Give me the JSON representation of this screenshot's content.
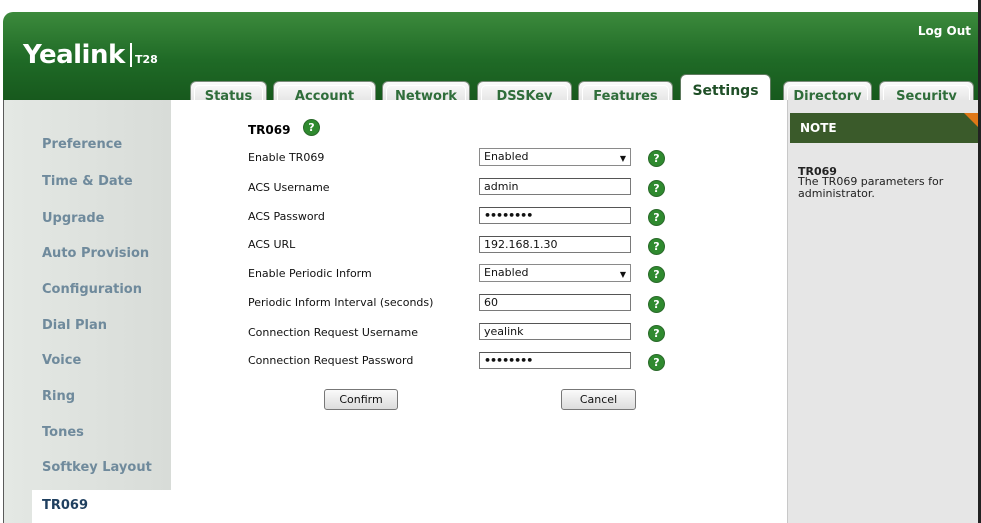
{
  "header": {
    "logo": "Yealink",
    "model": "T28",
    "logout": "Log Out"
  },
  "tabs": [
    {
      "label": "Status",
      "active": false
    },
    {
      "label": "Account",
      "active": false
    },
    {
      "label": "Network",
      "active": false
    },
    {
      "label": "DSSKey",
      "active": false
    },
    {
      "label": "Features",
      "active": false
    },
    {
      "label": "Settings",
      "active": true
    },
    {
      "label": "Directory",
      "active": false
    },
    {
      "label": "Security",
      "active": false
    }
  ],
  "sidebar": {
    "items": [
      {
        "label": "Preference"
      },
      {
        "label": "Time & Date"
      },
      {
        "label": "Upgrade"
      },
      {
        "label": "Auto Provision"
      },
      {
        "label": "Configuration"
      },
      {
        "label": "Dial Plan"
      },
      {
        "label": "Voice"
      },
      {
        "label": "Ring"
      },
      {
        "label": "Tones"
      },
      {
        "label": "Softkey Layout"
      },
      {
        "label": "TR069",
        "active": true
      }
    ]
  },
  "main": {
    "section_title": "TR069",
    "help_glyph": "?",
    "fields": [
      {
        "label": "Enable TR069",
        "type": "select",
        "value": "Enabled"
      },
      {
        "label": "ACS Username",
        "type": "text",
        "value": "admin"
      },
      {
        "label": "ACS Password",
        "type": "password",
        "value": "••••••••"
      },
      {
        "label": "ACS URL",
        "type": "text",
        "value": "192.168.1.30"
      },
      {
        "label": "Enable Periodic Inform",
        "type": "select",
        "value": "Enabled"
      },
      {
        "label": "Periodic Inform Interval (seconds)",
        "type": "text",
        "value": "60"
      },
      {
        "label": "Connection Request Username",
        "type": "text",
        "value": "yealink"
      },
      {
        "label": "Connection Request Password",
        "type": "password",
        "value": "••••••••"
      }
    ],
    "confirm_label": "Confirm",
    "cancel_label": "Cancel"
  },
  "note": {
    "title": "NOTE",
    "heading": "TR069",
    "text": "The TR069 parameters for administrator."
  },
  "colors": {
    "header_green": "#1f6a26",
    "help_green": "#2f8a2f",
    "note_head": "#3a5a2a",
    "note_corner": "#e07818",
    "sidebar_text": "#6f8a9c"
  }
}
